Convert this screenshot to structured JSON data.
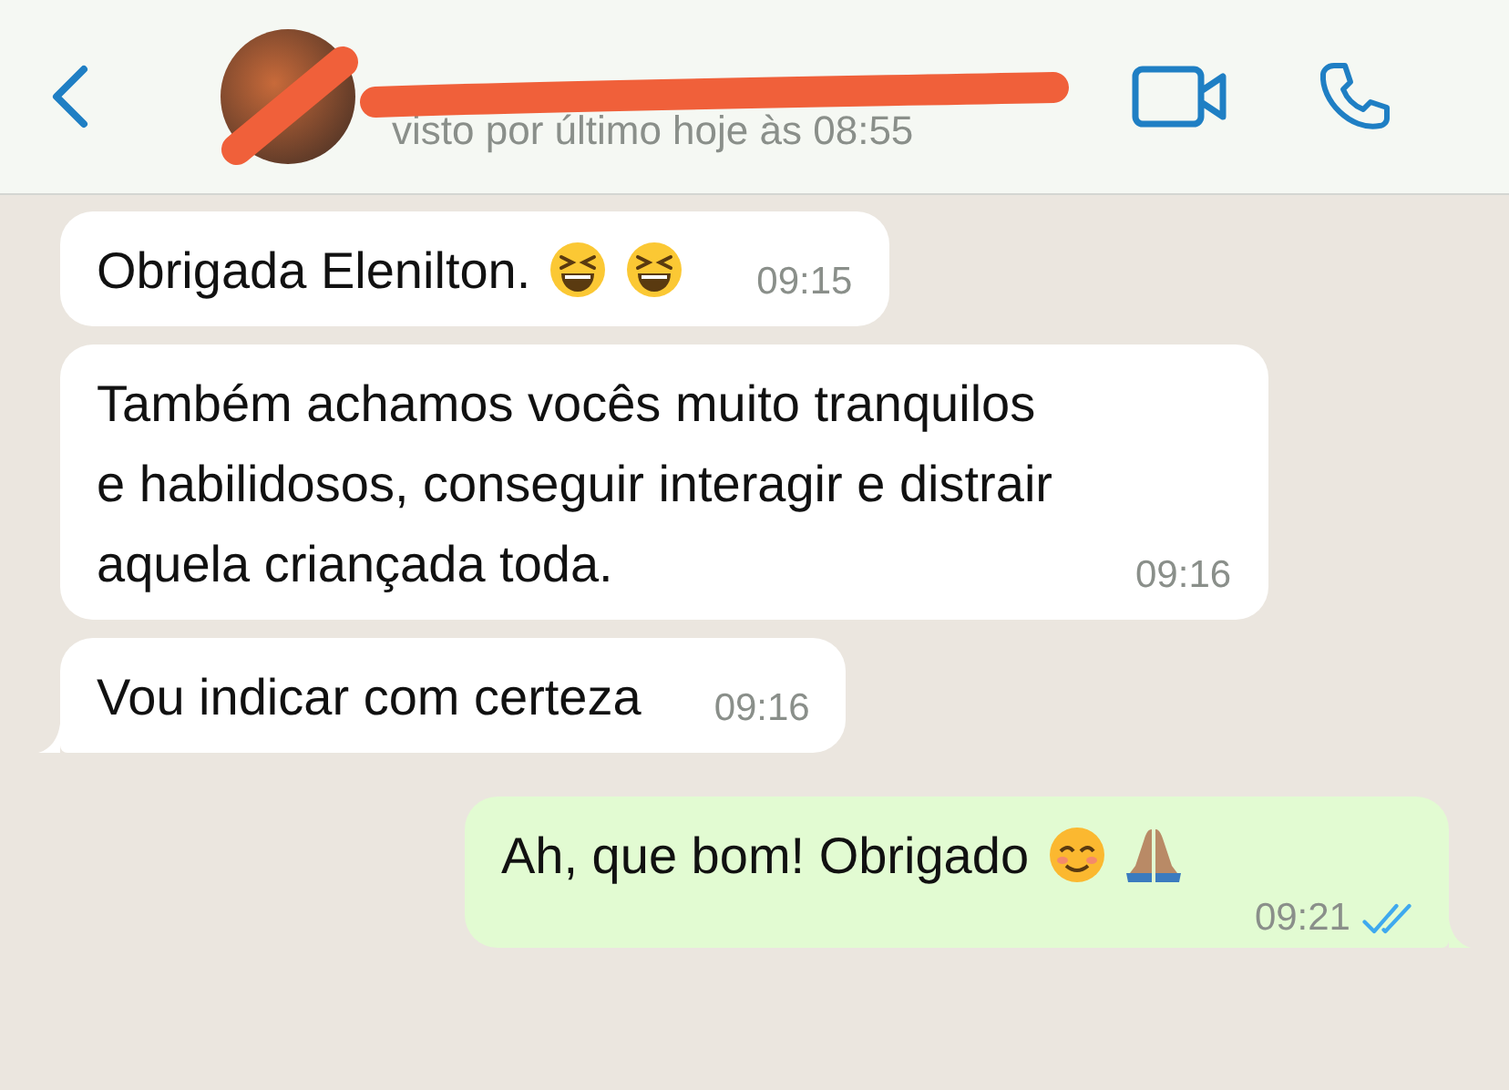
{
  "header": {
    "subtitle": "visto por último hoje às 08:55"
  },
  "messages": [
    {
      "kind": "incoming",
      "text": "Obrigada Elenilton.",
      "emoji": [
        {
          "kind": "laughing"
        },
        {
          "kind": "laughing"
        }
      ],
      "time": "09:15"
    },
    {
      "kind": "incoming",
      "text": "Também achamos vocês muito tranquilos e habilidosos, conseguir interagir e distrair aquela criançada toda.",
      "time": "09:16"
    },
    {
      "kind": "incoming",
      "text": "Vou indicar com certeza",
      "time": "09:16"
    },
    {
      "kind": "outgoing",
      "text": "Ah, que bom! Obrigado",
      "emoji": [
        {
          "kind": "smiling"
        },
        {
          "kind": "folded-hands"
        }
      ],
      "time": "09:21",
      "read": true
    }
  ]
}
